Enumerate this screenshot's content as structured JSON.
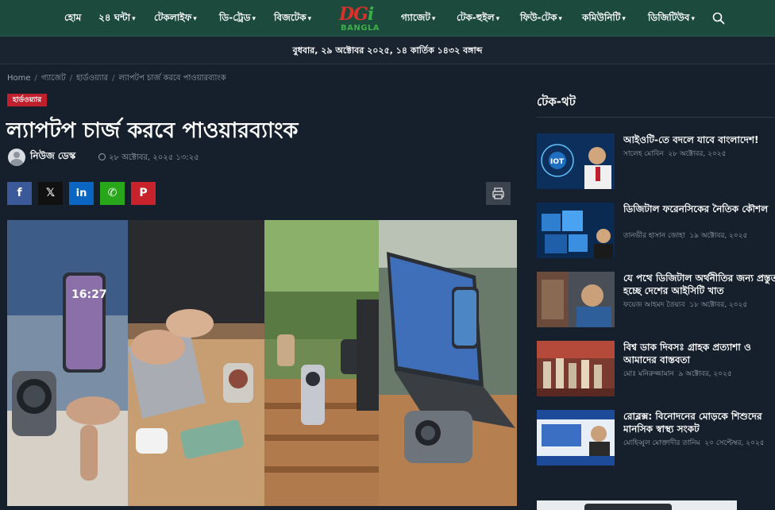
{
  "nav": {
    "items_left": [
      {
        "label": "হোম",
        "dropdown": false
      },
      {
        "label": "২৪ ঘন্টা",
        "dropdown": true
      },
      {
        "label": "টেকলাইফ",
        "dropdown": true
      },
      {
        "label": "ডি-ট্রেড",
        "dropdown": true
      },
      {
        "label": "বিজটেক",
        "dropdown": true
      }
    ],
    "items_right": [
      {
        "label": "গ্যাজেট",
        "dropdown": true
      },
      {
        "label": "টেক-হুইল",
        "dropdown": true
      },
      {
        "label": "ফিউ-টেক",
        "dropdown": true
      },
      {
        "label": "কমিউনিটি",
        "dropdown": true
      },
      {
        "label": "ডিজিটিউব",
        "dropdown": true
      }
    ],
    "logo": {
      "mark": "DGi",
      "text": "BANGLA"
    },
    "icons": {
      "search": "search-icon",
      "dropdown": "chevron-down-icon"
    }
  },
  "date_line": "বুধবার, ২৯ অক্টোবর ২০২৫, ১৪ কার্তিক ১৪৩২ বঙ্গাব্দ",
  "breadcrumb": [
    "Home",
    "গ্যাজেট",
    "হার্ডওয়্যার",
    "ল্যাপটপ চার্জ করবে পাওয়ারব্যাংক"
  ],
  "article": {
    "category": "হার্ডওয়্যার",
    "title": "ল্যাপটপ চার্জ করবে পাওয়ারব্যাংক",
    "author": "নিউজ ডেস্ক",
    "date": "২৮ অক্টোবর, ২০২৫ ১৩:২৫",
    "share": [
      {
        "name": "facebook",
        "glyph": "f",
        "color": "#3b5998"
      },
      {
        "name": "x",
        "glyph": "𝕏",
        "color": "#111111"
      },
      {
        "name": "linkedin",
        "glyph": "in",
        "color": "#0a66c2"
      },
      {
        "name": "whatsapp",
        "glyph": "✆",
        "color": "#29a71a"
      },
      {
        "name": "pinterest",
        "glyph": "P",
        "color": "#c8232c"
      }
    ],
    "phone_time": "16:27",
    "hero_image": "power bank charging phone and laptop collage"
  },
  "sidebar": {
    "title": "টেক-থট",
    "items": [
      {
        "headline": "আইওটি-তে বদলে যাবে বাংলাদেশ!",
        "author": "সালেহ মোবিন",
        "date": "২৮ অক্টোবর, ২০২৫",
        "thumb_text": "IOT"
      },
      {
        "headline": "ডিজিটাল ফরেনসিকের নৈতিক কৌশল",
        "author": "তানভীর হাসান জোহা",
        "date": "১৯ অক্টোবর, ২০২৫"
      },
      {
        "headline": "যে পথে ডিজিটাল অর্থনীতির জন্য প্রস্তুত হচ্ছে দেশের আইসিটি খাত",
        "author": "ফয়েজ আহমদ তৈয়্যব",
        "date": "১৮ অক্টোবর, ২০২৫"
      },
      {
        "headline": "বিশ্ব ডাক দিবসঃ গ্রাহক প্রত্যাশা ও আমাদের বাস্তবতা",
        "author": "মোঃ মনিরুজ্জামান",
        "date": "৯ অক্টোবর, ২০২৫"
      },
      {
        "headline": "রোব্লক্স: বিনোদনের মোড়কে শিশুদের মানসিক স্বাস্থ্য সংকট",
        "author": "মোহিব্বুল মোক্তাদীর তানিম",
        "date": "২০ সেপ্টেম্বর, ২০২৫"
      }
    ]
  },
  "colors": {
    "nav_bg": "#1c4a3c",
    "page_bg": "#16202c",
    "accent": "#c0202e"
  }
}
